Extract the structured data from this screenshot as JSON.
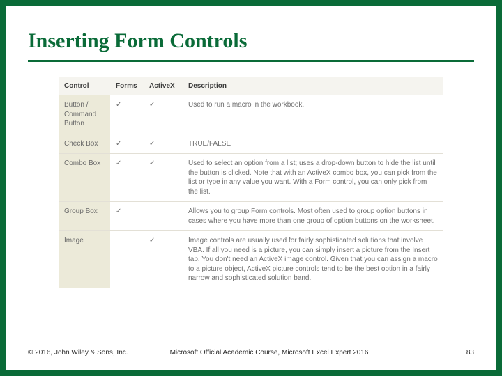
{
  "title": "Inserting Form Controls",
  "table": {
    "headers": {
      "control": "Control",
      "forms": "Forms",
      "activex": "ActiveX",
      "description": "Description"
    },
    "rows": [
      {
        "control": "Button / Command Button",
        "forms": "✓",
        "activex": "✓",
        "description": "Used to run a macro in the workbook."
      },
      {
        "control": "Check Box",
        "forms": "✓",
        "activex": "✓",
        "description": "TRUE/FALSE"
      },
      {
        "control": "Combo Box",
        "forms": "✓",
        "activex": "✓",
        "description": "Used to select an option from a list; uses a drop-down button to hide the list until the button is clicked. Note that with an ActiveX combo box, you can pick from the list or type in any value you want. With a Form control, you can only pick from the list."
      },
      {
        "control": "Group Box",
        "forms": "✓",
        "activex": "",
        "description": "Allows you to group Form controls. Most often used to group option buttons in cases where you have more than one group of option buttons on the worksheet."
      },
      {
        "control": "Image",
        "forms": "",
        "activex": "✓",
        "description": "Image controls are usually used for fairly sophisticated solutions that involve VBA. If all you need is a picture, you can simply insert a picture from the Insert tab. You don't need an ActiveX image control. Given that you can assign a macro to a picture object, ActiveX picture controls tend to be the best option in a fairly narrow and sophisticated solution band."
      }
    ]
  },
  "footer": {
    "copyright": "© 2016, John Wiley & Sons, Inc.",
    "course": "Microsoft Official Academic Course, Microsoft Excel Expert 2016",
    "page": "83"
  }
}
